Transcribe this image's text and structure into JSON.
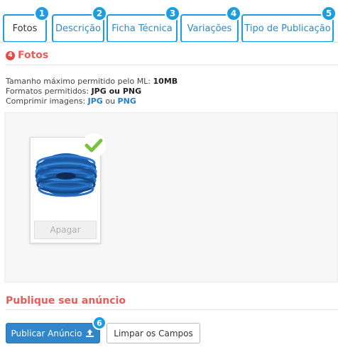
{
  "tabs": [
    {
      "label": "Fotos",
      "num": "1",
      "active": true
    },
    {
      "label": "Descrição",
      "num": "2"
    },
    {
      "label": "Ficha Técnica",
      "num": "3"
    },
    {
      "label": "Variações",
      "num": "4"
    },
    {
      "label": "Tipo de Publicação",
      "num": "5"
    }
  ],
  "section": {
    "badge": "4",
    "title": "Fotos"
  },
  "info": {
    "line1_prefix": "Tamanho máximo permitido pelo ML: ",
    "line1_value": "10MB",
    "line2_prefix": "Formatos permitidos: ",
    "line2_value": "JPG ou PNG",
    "line3_prefix": "Comprimir imagens: ",
    "line3_link1": "JPG",
    "line3_mid": " ou ",
    "line3_link2": "PNG"
  },
  "photo": {
    "delete_label": "Apagar"
  },
  "publish": {
    "title": "Publique seu anúncio",
    "primary_label": "Publicar Anúncio",
    "primary_num": "6",
    "clear_label": "Limpar os Campos"
  },
  "colors": {
    "accent": "#1a9ee0",
    "title_red": "#e85c5c",
    "primary_button": "#2f86c8",
    "check_green": "#7cc142"
  },
  "icons": {
    "check": "check-icon",
    "upload": "upload-icon"
  }
}
